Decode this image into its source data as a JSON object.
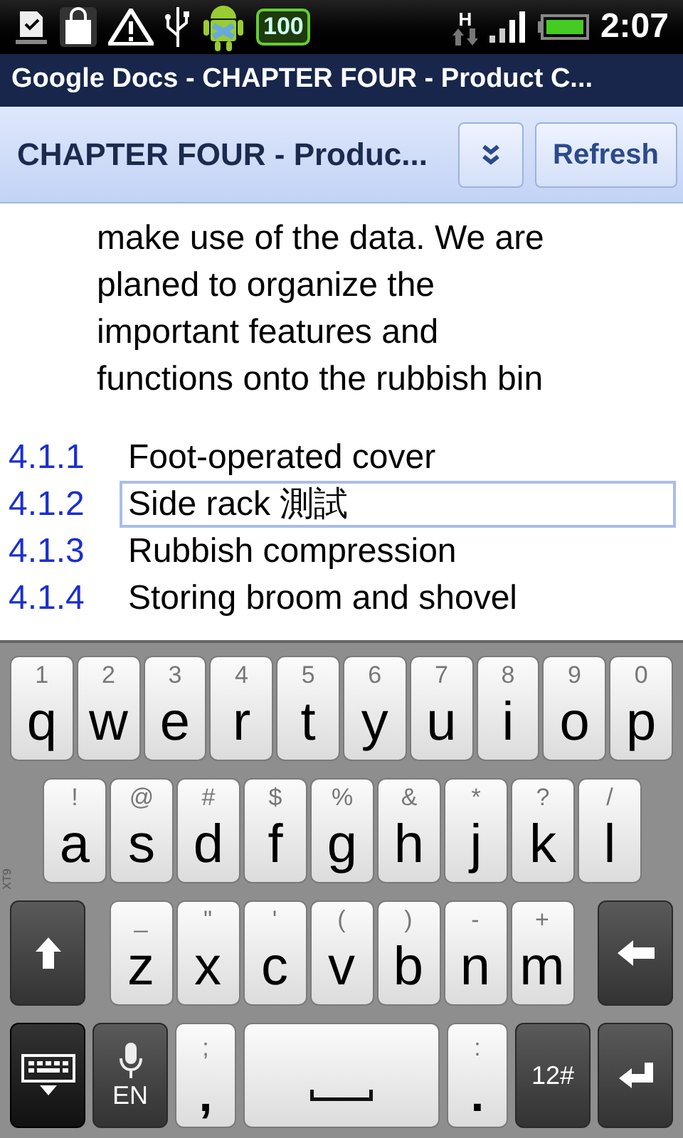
{
  "status_bar": {
    "battery_badge": "100",
    "network": "H",
    "time": "2:07"
  },
  "title_bar": {
    "title": "Google Docs - CHAPTER FOUR - Product C..."
  },
  "toolbar": {
    "title": "CHAPTER FOUR - Produc...",
    "refresh_button": "Refresh"
  },
  "document": {
    "paragraph_lines": [
      "make use of the data. We are",
      "planed to organize the",
      "important features and",
      "functions onto the rubbish bin"
    ],
    "outline": [
      {
        "number": "4.1.1",
        "title": "Foot-operated cover",
        "selected": false
      },
      {
        "number": "4.1.2",
        "title": "Side rack 測試",
        "selected": true
      },
      {
        "number": "4.1.3",
        "title": "Rubbish compression",
        "selected": false
      },
      {
        "number": "4.1.4",
        "title": "Storing broom and shovel",
        "selected": false
      }
    ]
  },
  "keyboard": {
    "side_label": "XT9",
    "rows": [
      {
        "keys": [
          {
            "kind": "letter",
            "main": "q",
            "alt": "1"
          },
          {
            "kind": "letter",
            "main": "w",
            "alt": "2"
          },
          {
            "kind": "letter",
            "main": "e",
            "alt": "3"
          },
          {
            "kind": "letter",
            "main": "r",
            "alt": "4"
          },
          {
            "kind": "letter",
            "main": "t",
            "alt": "5"
          },
          {
            "kind": "letter",
            "main": "y",
            "alt": "6"
          },
          {
            "kind": "letter",
            "main": "u",
            "alt": "7"
          },
          {
            "kind": "letter",
            "main": "i",
            "alt": "8"
          },
          {
            "kind": "letter",
            "main": "o",
            "alt": "9"
          },
          {
            "kind": "letter",
            "main": "p",
            "alt": "0"
          }
        ]
      },
      {
        "keys": [
          {
            "kind": "letter",
            "main": "a",
            "alt": "!"
          },
          {
            "kind": "letter",
            "main": "s",
            "alt": "@"
          },
          {
            "kind": "letter",
            "main": "d",
            "alt": "#"
          },
          {
            "kind": "letter",
            "main": "f",
            "alt": "$"
          },
          {
            "kind": "letter",
            "main": "g",
            "alt": "%"
          },
          {
            "kind": "letter",
            "main": "h",
            "alt": "&"
          },
          {
            "kind": "letter",
            "main": "j",
            "alt": "*"
          },
          {
            "kind": "letter",
            "main": "k",
            "alt": "?"
          },
          {
            "kind": "letter",
            "main": "l",
            "alt": "/"
          }
        ]
      },
      {
        "keys": [
          {
            "kind": "shift"
          },
          {
            "kind": "letter",
            "main": "z",
            "alt": "_"
          },
          {
            "kind": "letter",
            "main": "x",
            "alt": "\""
          },
          {
            "kind": "letter",
            "main": "c",
            "alt": "'"
          },
          {
            "kind": "letter",
            "main": "v",
            "alt": "("
          },
          {
            "kind": "letter",
            "main": "b",
            "alt": ")"
          },
          {
            "kind": "letter",
            "main": "n",
            "alt": "-"
          },
          {
            "kind": "letter",
            "main": "m",
            "alt": "+"
          },
          {
            "kind": "backspace"
          }
        ]
      },
      {
        "keys": [
          {
            "kind": "hide"
          },
          {
            "kind": "mic",
            "main": "EN"
          },
          {
            "kind": "punct",
            "main": ",",
            "alt": ";"
          },
          {
            "kind": "space"
          },
          {
            "kind": "punct",
            "main": ".",
            "alt": ":"
          },
          {
            "kind": "symbols",
            "main": "12#"
          },
          {
            "kind": "enter"
          }
        ]
      }
    ]
  }
}
